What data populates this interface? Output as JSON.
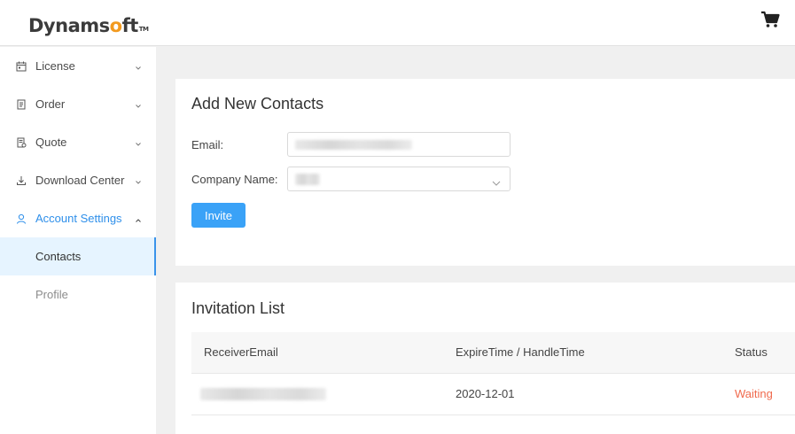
{
  "header": {
    "logo": {
      "prefix": "Dynams",
      "accent": "o",
      "suffix": "ft",
      "tm": "TM",
      "accent_color": "#f29a1f"
    },
    "cart_icon": "shopping-cart-icon"
  },
  "sidebar": {
    "items": [
      {
        "label": "License",
        "icon": "license-icon",
        "expanded": false
      },
      {
        "label": "Order",
        "icon": "order-icon",
        "expanded": false
      },
      {
        "label": "Quote",
        "icon": "quote-icon",
        "expanded": false
      },
      {
        "label": "Download Center",
        "icon": "download-icon",
        "expanded": false
      },
      {
        "label": "Account Settings",
        "icon": "user-icon",
        "expanded": true
      }
    ],
    "subitems": [
      {
        "label": "Contacts",
        "selected": true
      },
      {
        "label": "Profile",
        "selected": false
      }
    ],
    "active_color": "#2e8fea"
  },
  "add_contacts": {
    "title": "Add New Contacts",
    "email_label": "Email:",
    "email_value": "",
    "company_label": "Company Name:",
    "company_value": "",
    "invite_label": "Invite",
    "button_color": "#3aa2f7"
  },
  "invitation_list": {
    "title": "Invitation List",
    "columns": [
      "ReceiverEmail",
      "ExpireTime / HandleTime",
      "Status"
    ],
    "rows": [
      {
        "receiver_email": "",
        "time": "2020-12-01",
        "status": "Waiting"
      }
    ],
    "status_color": "#f06a4d"
  }
}
